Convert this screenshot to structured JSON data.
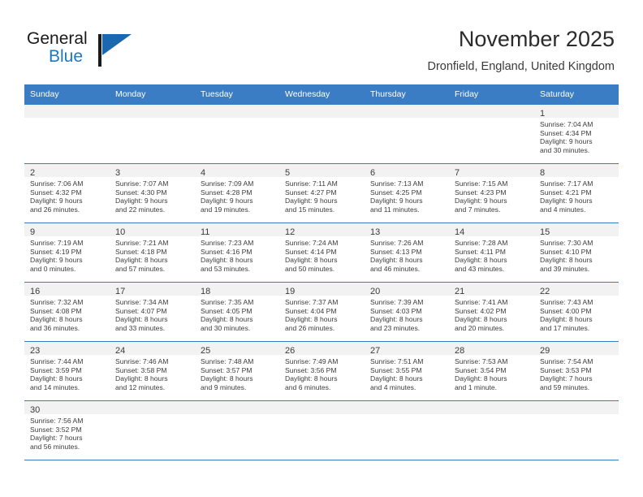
{
  "brand": {
    "name_part1": "General",
    "name_part2": "Blue",
    "accent_color": "#1a68b0"
  },
  "header": {
    "title": "November 2025",
    "subtitle": "Dronfield, England, United Kingdom",
    "header_bg": "#3b7dc4"
  },
  "weekdays": [
    {
      "label": "Sunday"
    },
    {
      "label": "Monday"
    },
    {
      "label": "Tuesday"
    },
    {
      "label": "Wednesday"
    },
    {
      "label": "Thursday"
    },
    {
      "label": "Friday"
    },
    {
      "label": "Saturday"
    }
  ],
  "weeks": [
    {
      "days": [
        {
          "empty": true
        },
        {
          "empty": true
        },
        {
          "empty": true
        },
        {
          "empty": true
        },
        {
          "empty": true
        },
        {
          "empty": true
        },
        {
          "day": "1",
          "sunrise": "Sunrise: 7:04 AM",
          "sunset": "Sunset: 4:34 PM",
          "daylight1": "Daylight: 9 hours",
          "daylight2": "and 30 minutes."
        }
      ]
    },
    {
      "days": [
        {
          "day": "2",
          "sunrise": "Sunrise: 7:06 AM",
          "sunset": "Sunset: 4:32 PM",
          "daylight1": "Daylight: 9 hours",
          "daylight2": "and 26 minutes."
        },
        {
          "day": "3",
          "sunrise": "Sunrise: 7:07 AM",
          "sunset": "Sunset: 4:30 PM",
          "daylight1": "Daylight: 9 hours",
          "daylight2": "and 22 minutes."
        },
        {
          "day": "4",
          "sunrise": "Sunrise: 7:09 AM",
          "sunset": "Sunset: 4:28 PM",
          "daylight1": "Daylight: 9 hours",
          "daylight2": "and 19 minutes."
        },
        {
          "day": "5",
          "sunrise": "Sunrise: 7:11 AM",
          "sunset": "Sunset: 4:27 PM",
          "daylight1": "Daylight: 9 hours",
          "daylight2": "and 15 minutes."
        },
        {
          "day": "6",
          "sunrise": "Sunrise: 7:13 AM",
          "sunset": "Sunset: 4:25 PM",
          "daylight1": "Daylight: 9 hours",
          "daylight2": "and 11 minutes."
        },
        {
          "day": "7",
          "sunrise": "Sunrise: 7:15 AM",
          "sunset": "Sunset: 4:23 PM",
          "daylight1": "Daylight: 9 hours",
          "daylight2": "and 7 minutes."
        },
        {
          "day": "8",
          "sunrise": "Sunrise: 7:17 AM",
          "sunset": "Sunset: 4:21 PM",
          "daylight1": "Daylight: 9 hours",
          "daylight2": "and 4 minutes."
        }
      ]
    },
    {
      "days": [
        {
          "day": "9",
          "sunrise": "Sunrise: 7:19 AM",
          "sunset": "Sunset: 4:19 PM",
          "daylight1": "Daylight: 9 hours",
          "daylight2": "and 0 minutes."
        },
        {
          "day": "10",
          "sunrise": "Sunrise: 7:21 AM",
          "sunset": "Sunset: 4:18 PM",
          "daylight1": "Daylight: 8 hours",
          "daylight2": "and 57 minutes."
        },
        {
          "day": "11",
          "sunrise": "Sunrise: 7:23 AM",
          "sunset": "Sunset: 4:16 PM",
          "daylight1": "Daylight: 8 hours",
          "daylight2": "and 53 minutes."
        },
        {
          "day": "12",
          "sunrise": "Sunrise: 7:24 AM",
          "sunset": "Sunset: 4:14 PM",
          "daylight1": "Daylight: 8 hours",
          "daylight2": "and 50 minutes."
        },
        {
          "day": "13",
          "sunrise": "Sunrise: 7:26 AM",
          "sunset": "Sunset: 4:13 PM",
          "daylight1": "Daylight: 8 hours",
          "daylight2": "and 46 minutes."
        },
        {
          "day": "14",
          "sunrise": "Sunrise: 7:28 AM",
          "sunset": "Sunset: 4:11 PM",
          "daylight1": "Daylight: 8 hours",
          "daylight2": "and 43 minutes."
        },
        {
          "day": "15",
          "sunrise": "Sunrise: 7:30 AM",
          "sunset": "Sunset: 4:10 PM",
          "daylight1": "Daylight: 8 hours",
          "daylight2": "and 39 minutes."
        }
      ]
    },
    {
      "days": [
        {
          "day": "16",
          "sunrise": "Sunrise: 7:32 AM",
          "sunset": "Sunset: 4:08 PM",
          "daylight1": "Daylight: 8 hours",
          "daylight2": "and 36 minutes."
        },
        {
          "day": "17",
          "sunrise": "Sunrise: 7:34 AM",
          "sunset": "Sunset: 4:07 PM",
          "daylight1": "Daylight: 8 hours",
          "daylight2": "and 33 minutes."
        },
        {
          "day": "18",
          "sunrise": "Sunrise: 7:35 AM",
          "sunset": "Sunset: 4:05 PM",
          "daylight1": "Daylight: 8 hours",
          "daylight2": "and 30 minutes."
        },
        {
          "day": "19",
          "sunrise": "Sunrise: 7:37 AM",
          "sunset": "Sunset: 4:04 PM",
          "daylight1": "Daylight: 8 hours",
          "daylight2": "and 26 minutes."
        },
        {
          "day": "20",
          "sunrise": "Sunrise: 7:39 AM",
          "sunset": "Sunset: 4:03 PM",
          "daylight1": "Daylight: 8 hours",
          "daylight2": "and 23 minutes."
        },
        {
          "day": "21",
          "sunrise": "Sunrise: 7:41 AM",
          "sunset": "Sunset: 4:02 PM",
          "daylight1": "Daylight: 8 hours",
          "daylight2": "and 20 minutes."
        },
        {
          "day": "22",
          "sunrise": "Sunrise: 7:43 AM",
          "sunset": "Sunset: 4:00 PM",
          "daylight1": "Daylight: 8 hours",
          "daylight2": "and 17 minutes."
        }
      ]
    },
    {
      "days": [
        {
          "day": "23",
          "sunrise": "Sunrise: 7:44 AM",
          "sunset": "Sunset: 3:59 PM",
          "daylight1": "Daylight: 8 hours",
          "daylight2": "and 14 minutes."
        },
        {
          "day": "24",
          "sunrise": "Sunrise: 7:46 AM",
          "sunset": "Sunset: 3:58 PM",
          "daylight1": "Daylight: 8 hours",
          "daylight2": "and 12 minutes."
        },
        {
          "day": "25",
          "sunrise": "Sunrise: 7:48 AM",
          "sunset": "Sunset: 3:57 PM",
          "daylight1": "Daylight: 8 hours",
          "daylight2": "and 9 minutes."
        },
        {
          "day": "26",
          "sunrise": "Sunrise: 7:49 AM",
          "sunset": "Sunset: 3:56 PM",
          "daylight1": "Daylight: 8 hours",
          "daylight2": "and 6 minutes."
        },
        {
          "day": "27",
          "sunrise": "Sunrise: 7:51 AM",
          "sunset": "Sunset: 3:55 PM",
          "daylight1": "Daylight: 8 hours",
          "daylight2": "and 4 minutes."
        },
        {
          "day": "28",
          "sunrise": "Sunrise: 7:53 AM",
          "sunset": "Sunset: 3:54 PM",
          "daylight1": "Daylight: 8 hours",
          "daylight2": "and 1 minute."
        },
        {
          "day": "29",
          "sunrise": "Sunrise: 7:54 AM",
          "sunset": "Sunset: 3:53 PM",
          "daylight1": "Daylight: 7 hours",
          "daylight2": "and 59 minutes."
        }
      ]
    },
    {
      "days": [
        {
          "day": "30",
          "sunrise": "Sunrise: 7:56 AM",
          "sunset": "Sunset: 3:52 PM",
          "daylight1": "Daylight: 7 hours",
          "daylight2": "and 56 minutes."
        },
        {
          "empty": true
        },
        {
          "empty": true
        },
        {
          "empty": true
        },
        {
          "empty": true
        },
        {
          "empty": true
        },
        {
          "empty": true
        }
      ]
    }
  ]
}
